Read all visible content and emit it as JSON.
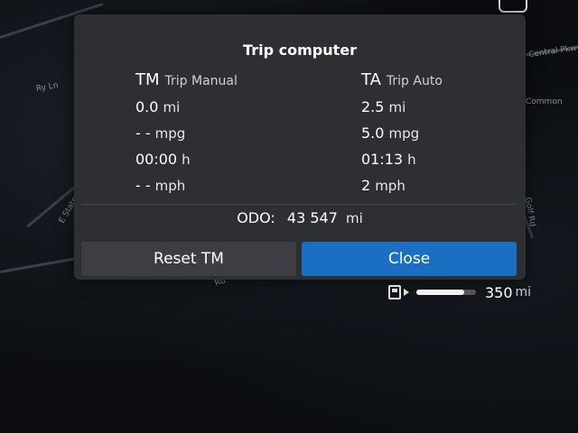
{
  "dialog": {
    "title": "Trip computer",
    "trip_manual": {
      "abbr": "TM",
      "name": "Trip Manual",
      "rows": [
        {
          "value": "0.0",
          "unit": "mi"
        },
        {
          "value": "- -",
          "unit": "mpg"
        },
        {
          "value": "00:00",
          "unit": "h"
        },
        {
          "value": "- -",
          "unit": "mph"
        }
      ]
    },
    "trip_auto": {
      "abbr": "TA",
      "name": "Trip Auto",
      "rows": [
        {
          "value": "2.5",
          "unit": "mi"
        },
        {
          "value": "5.0",
          "unit": "mpg"
        },
        {
          "value": "01:13",
          "unit": "h"
        },
        {
          "value": "2",
          "unit": "mph"
        }
      ]
    },
    "odo": {
      "label": "ODO:",
      "value": "43 547",
      "unit": "mi"
    },
    "buttons": {
      "reset": "Reset TM",
      "close": "Close"
    }
  },
  "fuel": {
    "range": "350",
    "unit": "mi",
    "level_percent": 80
  },
  "map_labels": [
    "E State",
    "Golf Rd",
    "Common",
    "Ry Ln",
    "Central Pkwy",
    "Rd"
  ],
  "colors": {
    "close_button": "#1b6fc2",
    "dialog_bg": "#2d2f33",
    "reset_button": "#3c3e43"
  }
}
